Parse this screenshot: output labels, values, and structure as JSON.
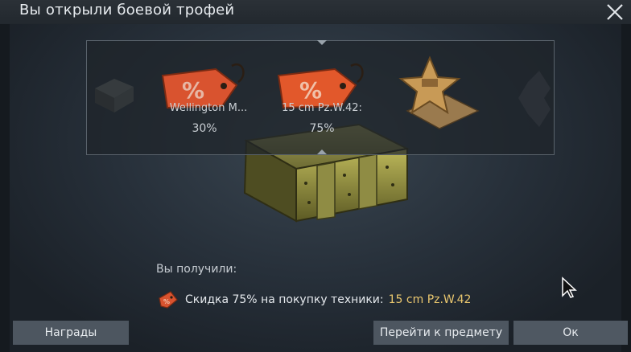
{
  "window": {
    "title": "Вы открыли боевой трофей"
  },
  "carousel": {
    "items": [
      {
        "label": "Wellington M...",
        "percent": "30%"
      },
      {
        "label": "15 cm Pz.W.42:",
        "percent": "75%"
      }
    ]
  },
  "result": {
    "heading": "Вы получили:",
    "reward_text": "Скидка 75% на покупку техники:",
    "reward_item": "15 cm Pz.W.42"
  },
  "buttons": {
    "rewards": "Награды",
    "go_to_item": "Перейти к предмету",
    "ok": "Ок"
  },
  "colors": {
    "accent_highlight": "#e8c66e",
    "tag": "#d9532f"
  }
}
